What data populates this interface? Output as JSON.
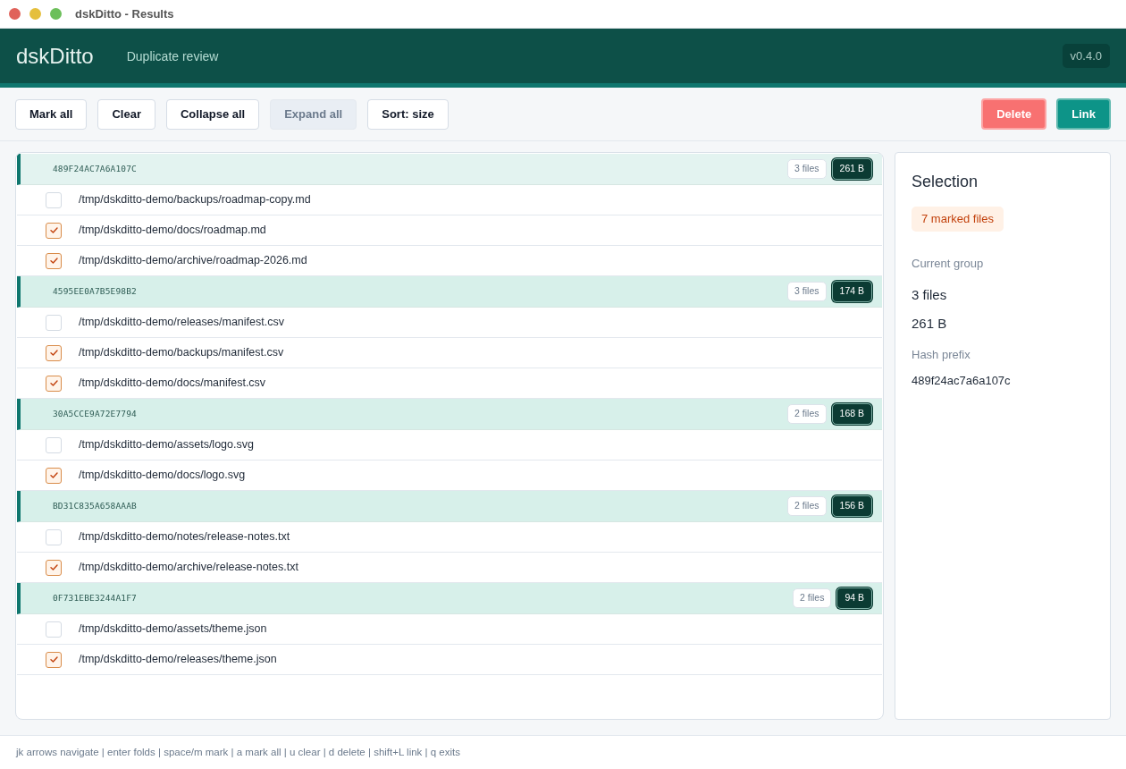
{
  "window": {
    "title": "dskDitto - Results"
  },
  "header": {
    "app_name": "dskDitto",
    "subtitle": "Duplicate review",
    "version": "v0.4.0"
  },
  "toolbar": {
    "buttons": [
      {
        "label": "Mark all",
        "disabled": false
      },
      {
        "label": "Clear",
        "disabled": false
      },
      {
        "label": "Collapse all",
        "disabled": false
      },
      {
        "label": "Expand all",
        "disabled": true
      },
      {
        "label": "Sort: size",
        "disabled": false
      }
    ],
    "actions": [
      {
        "label": "Delete",
        "kind": "danger"
      },
      {
        "label": "Link",
        "kind": "primary"
      }
    ]
  },
  "groups": [
    {
      "hash": "489F24AC7A6A107C",
      "count": "3 files",
      "size": "261 B",
      "selected": true,
      "files": [
        {
          "path": "/tmp/dskditto-demo/backups/roadmap-copy.md",
          "checked": false
        },
        {
          "path": "/tmp/dskditto-demo/docs/roadmap.md",
          "checked": true
        },
        {
          "path": "/tmp/dskditto-demo/archive/roadmap-2026.md",
          "checked": true
        }
      ]
    },
    {
      "hash": "4595EE0A7B5E98B2",
      "count": "3 files",
      "size": "174 B",
      "selected": false,
      "files": [
        {
          "path": "/tmp/dskditto-demo/releases/manifest.csv",
          "checked": false
        },
        {
          "path": "/tmp/dskditto-demo/backups/manifest.csv",
          "checked": true
        },
        {
          "path": "/tmp/dskditto-demo/docs/manifest.csv",
          "checked": true
        }
      ]
    },
    {
      "hash": "30A5CCE9A72E7794",
      "count": "2 files",
      "size": "168 B",
      "selected": false,
      "files": [
        {
          "path": "/tmp/dskditto-demo/assets/logo.svg",
          "checked": false
        },
        {
          "path": "/tmp/dskditto-demo/docs/logo.svg",
          "checked": true
        }
      ]
    },
    {
      "hash": "BD31C835A658AAAB",
      "count": "2 files",
      "size": "156 B",
      "selected": false,
      "files": [
        {
          "path": "/tmp/dskditto-demo/notes/release-notes.txt",
          "checked": false
        },
        {
          "path": "/tmp/dskditto-demo/archive/release-notes.txt",
          "checked": true
        }
      ]
    },
    {
      "hash": "0F731EBE3244A1F7",
      "count": "2 files",
      "size": "94 B",
      "selected": false,
      "files": [
        {
          "path": "/tmp/dskditto-demo/assets/theme.json",
          "checked": false
        },
        {
          "path": "/tmp/dskditto-demo/releases/theme.json",
          "checked": true
        }
      ]
    }
  ],
  "sidebar": {
    "title": "Selection",
    "marked_badge": "7 marked files",
    "current_group_label": "Current group",
    "current_group_count": "3 files",
    "current_group_size": "261 B",
    "hash_prefix_label": "Hash prefix",
    "hash_prefix": "489f24ac7a6a107c"
  },
  "status_bar": "jk arrows navigate | enter folds | space/m mark | a mark all | u clear | d delete | shift+L link | q exits"
}
